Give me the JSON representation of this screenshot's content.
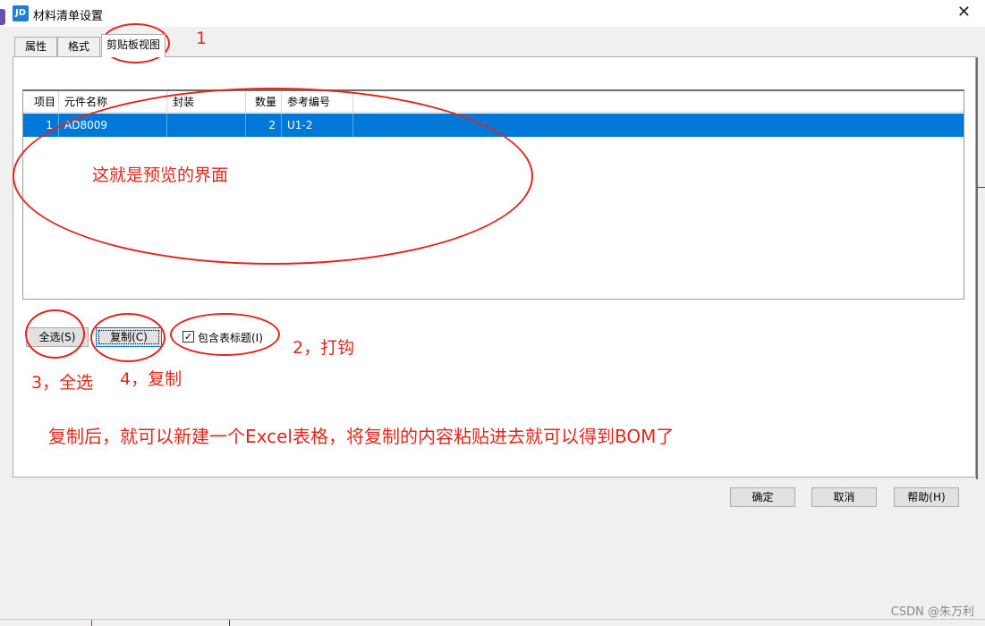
{
  "window": {
    "title": "材料清单设置",
    "app_icon_text": "JD",
    "close_symbol": "✕"
  },
  "tabs": [
    {
      "label": "属性",
      "active": false
    },
    {
      "label": "格式",
      "active": false
    },
    {
      "label": "剪贴板视图",
      "active": true
    }
  ],
  "table": {
    "headers": [
      "项目",
      "元件名称",
      "封装",
      "数量",
      "参考编号"
    ],
    "rows": [
      {
        "item": "1",
        "name": "AD8009",
        "package": "",
        "qty": "2",
        "ref": "U1-2",
        "selected": true
      }
    ]
  },
  "controls": {
    "select_all": "全选(S)",
    "copy": "复制(C)",
    "include_header_label": "包含表标题(I)",
    "include_header_checked": true
  },
  "footer": {
    "ok": "确定",
    "cancel": "取消",
    "help": "帮助(H)"
  },
  "annotations": {
    "n1": "1",
    "preview": "这就是预览的界面",
    "n2": "2，打钩",
    "n3": "3，全选",
    "n4": "4，复制",
    "note": "复制后，就可以新建一个Excel表格，将复制的内容粘贴进去就可以得到BOM了",
    "color": "#e1261c"
  },
  "watermark": "CSDN @朱万利",
  "colors": {
    "selection": "#0078d7",
    "dialog_bg": "#f0f0f0"
  }
}
